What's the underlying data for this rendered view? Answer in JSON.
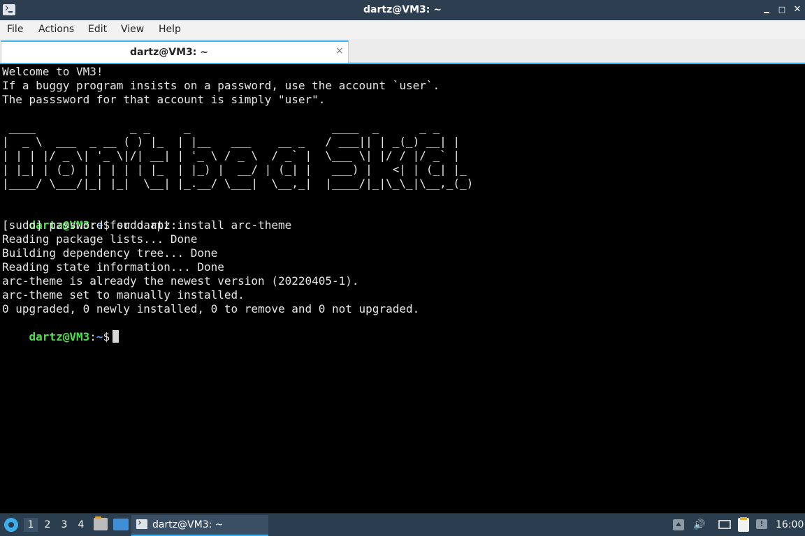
{
  "window": {
    "title": "dartz@VM3: ~",
    "min_glyph": "",
    "max_glyph": "□",
    "close_glyph": "✕"
  },
  "menu": [
    "File",
    "Actions",
    "Edit",
    "View",
    "Help"
  ],
  "tab": {
    "label": "dartz@VM3: ~",
    "close_glyph": "×"
  },
  "terminal": {
    "welcome": [
      "Welcome to VM3!",
      "If a buggy program insists on a password, use the account `user`.",
      "The passsword for that account is simply \"user\"."
    ],
    "ascii_art": [
      " ____              _ _     _                     ____  _      _ _",
      "|  _ \\  ___  _ __ ( ) |_  | |__   ___    __ _   / ___|| | _(_) __| |",
      "| | | |/ _ \\| '_ \\|/| __| | '_ \\ / _ \\  / _` |  \\___ \\| |/ / |/ _` |",
      "| |_| | (_) | | | | | |_  | |_) |  __/ | (_| |   ___) |   <| | (_| |_",
      "|____/ \\___/|_| |_|  \\__| |_.__/ \\___|  \\__,_|  |____/|_|\\_\\_|\\__,_(_)"
    ],
    "prompt": {
      "user_host": "dartz@VM3",
      "sep": ":",
      "path": "~",
      "symbol": "$"
    },
    "command": " sudo apt install arc-theme",
    "output": [
      "[sudo] password for dartz:",
      "Reading package lists... Done",
      "Building dependency tree... Done",
      "Reading state information... Done",
      "arc-theme is already the newest version (20220405-1).",
      "arc-theme set to manually installed.",
      "0 upgraded, 0 newly installed, 0 to remove and 0 not upgraded."
    ]
  },
  "taskbar": {
    "workspaces": [
      "1",
      "2",
      "3",
      "4"
    ],
    "task_label": "dartz@VM3: ~",
    "volume_glyph": "🔊",
    "notify_glyph": "!",
    "clock": "16:00"
  },
  "colors": {
    "titlebar": "#2c3e50",
    "accent": "#3daee9",
    "prompt_user": "#4ce04c",
    "prompt_path": "#54a8ff",
    "terminal_bg": "#000000"
  },
  "icons": [
    "terminal-icon",
    "start-menu-icon",
    "file-manager-icon",
    "show-desktop-icon",
    "tray-expand-icon",
    "volume-icon",
    "network-icon",
    "clipboard-icon",
    "notification-icon"
  ]
}
